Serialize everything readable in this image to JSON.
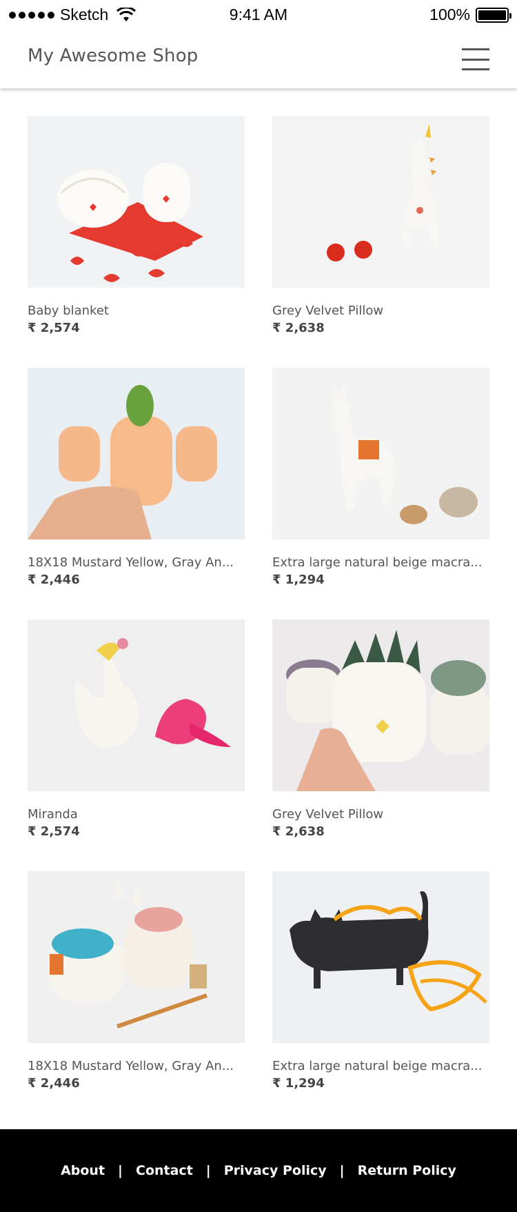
{
  "status_bar": {
    "carrier": "Sketch",
    "time": "9:41 AM",
    "battery": "100%"
  },
  "header": {
    "title": "My Awesome Shop",
    "menu_icon": "hamburger-menu-icon"
  },
  "products": [
    {
      "name": "Baby blanket",
      "price": "₹ 2,574",
      "image": "ceramic-couple-on-red-heart"
    },
    {
      "name": "Grey Velvet Pillow",
      "price": "₹ 2,638",
      "image": "ceramic-unicorn-with-red-balls"
    },
    {
      "name": "18X18 Mustard Yellow, Gray An...",
      "price": "₹ 2,446",
      "image": "peach-monkey-planter-with-cactus"
    },
    {
      "name": "Extra large natural beige macra...",
      "price": "₹ 1,294",
      "image": "ceramic-llama-with-stones"
    },
    {
      "name": "Miranda",
      "price": "₹ 2,574",
      "image": "ceramic-bird-with-pink-flower"
    },
    {
      "name": "Grey Velvet Pillow",
      "price": "₹ 2,638",
      "image": "ceramic-planter-with-succulent"
    },
    {
      "name": "18X18 Mustard Yellow, Gray An...",
      "price": "₹ 2,446",
      "image": "llama-yarn-bowls"
    },
    {
      "name": "Extra large natural beige macra...",
      "price": "₹ 1,294",
      "image": "black-cat-bowl-with-ribbon"
    }
  ],
  "footer": {
    "links": [
      "About",
      "Contact",
      "Privacy Policy",
      "Return Policy"
    ],
    "separator": "|"
  }
}
